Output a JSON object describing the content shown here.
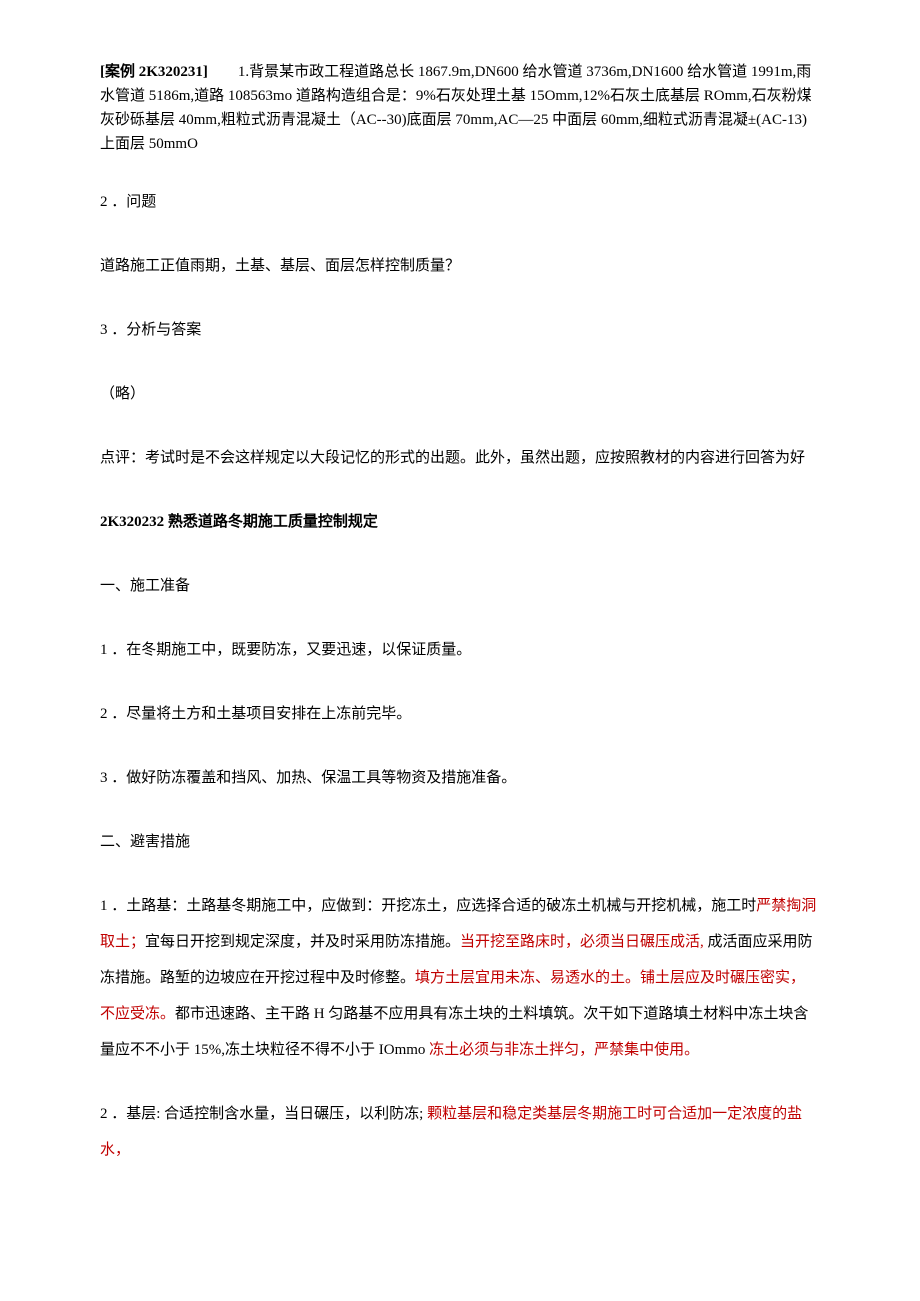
{
  "case": {
    "label": "[案例 2K320231]",
    "background": "　　1.背景某市政工程道路总长 1867.9m,DN600 给水管道 3736m,DN1600 给水管道 1991m,雨水管道 5186m,道路 108563mo 道路构造组合是：9%石灰处理土基 15Omm,12%石灰土底基层 ROmm,石灰粉煤灰砂砾基层 40mm,粗粒式沥青混凝土（AC--30)底面层 70mm,AC—25 中面层 60mm,细粒式沥青混凝±(AC-13)上面层 50mmO"
  },
  "q_num": "2 ．问题",
  "q_text": "道路施工正值雨期，土基、基层、面层怎样控制质量？",
  "a_num": "3 ．分析与答案",
  "a_text": "（略）",
  "commentary": "点评：考试时是不会这样规定以大段记忆的形式的出题。此外，虽然出题，应按照教材的内容进行回答为好",
  "section2_title": "2K320232 熟悉道路冬期施工质量控制规定",
  "prep_heading": "一、施工准备",
  "prep_items": {
    "i1": "1 ．在冬期施工中，既要防冻，又要迅速，以保证质量。",
    "i2": "2 ．尽量将土方和土基项目安排在上冻前完毕。",
    "i3": "3 ．做好防冻覆盖和挡风、加热、保温工具等物资及措施准备。"
  },
  "hazard_heading": "二、避害措施",
  "hazard": {
    "p1_a": "1 ．土路基：土路基冬期施工中，应做到：开挖冻土，应选择合适的破冻土机械与开挖机械，施工时",
    "p1_red1": "严禁掏洞取土；",
    "p1_b": "宜每日开挖到规定深度，并及时采用防冻措施。",
    "p1_red2": "当开挖至路床时，必须当日碾压成活,",
    "p1_c": " 成活面应采用防冻措施。路堑的边坡应在开挖过程中及时修整。",
    "p1_red3": "填方土层宜用未冻、易透水的土。铺土层应及时碾压密实，不应受冻。",
    "p1_d": "都市迅速路、主干路 H 匀路基不应用具有冻土块的土料填筑。次干如下道路填土材料中冻土块含量应不不小于 15%,冻土块粒径不得不小于 IOmmo ",
    "p1_red4": "冻土必须与非冻土拌匀，严禁集中使用。",
    "p2_a": "2 ．基层: 合适控制含水量，当日碾压，以利防冻; ",
    "p2_red1": "颗粒基层和稳定类基层冬期施工时可合适加一定浓度的盐水，"
  }
}
